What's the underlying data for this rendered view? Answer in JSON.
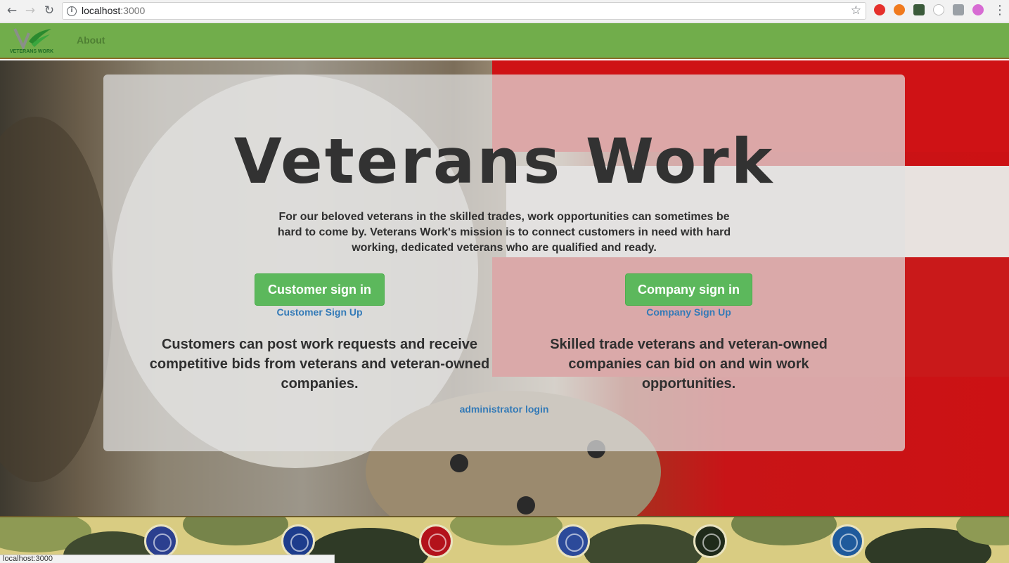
{
  "browser": {
    "url_host": "localhost",
    "url_port": ":3000",
    "status_text": "localhost:3000"
  },
  "navbar": {
    "logo_text": "VETERANS WORK",
    "about_label": "About"
  },
  "hero": {
    "title": "Veterans Work",
    "mission": "For our beloved veterans in the skilled trades, work opportunities can sometimes be hard to come by. Veterans Work's mission is to connect customers in need with hard working, dedicated veterans who are qualified and ready.",
    "customer": {
      "signin_label": "Customer sign in",
      "signup_label": "Customer Sign Up",
      "blurb": "Customers can post work requests and receive competitive bids from veterans and veteran-owned companies."
    },
    "company": {
      "signin_label": "Company sign in",
      "signup_label": "Company Sign Up",
      "blurb": "Skilled trade veterans and veteran-owned companies can bid on and win work opportunities."
    },
    "admin_label": "administrator login"
  },
  "footer": {
    "seals": [
      {
        "name": "air-force-seal-icon",
        "color": "#2b3f8f"
      },
      {
        "name": "national-guard-seal-icon",
        "color": "#1d3c8c"
      },
      {
        "name": "marine-corps-seal-icon",
        "color": "#b3121b"
      },
      {
        "name": "navy-seal-icon",
        "color": "#2c4a9a"
      },
      {
        "name": "army-seal-icon",
        "color": "#1f2a1a"
      },
      {
        "name": "coast-guard-seal-icon",
        "color": "#1f5a9c"
      }
    ]
  },
  "colors": {
    "navbar": "#71ad4b",
    "button": "#5cb85c",
    "link": "#337ab7"
  }
}
